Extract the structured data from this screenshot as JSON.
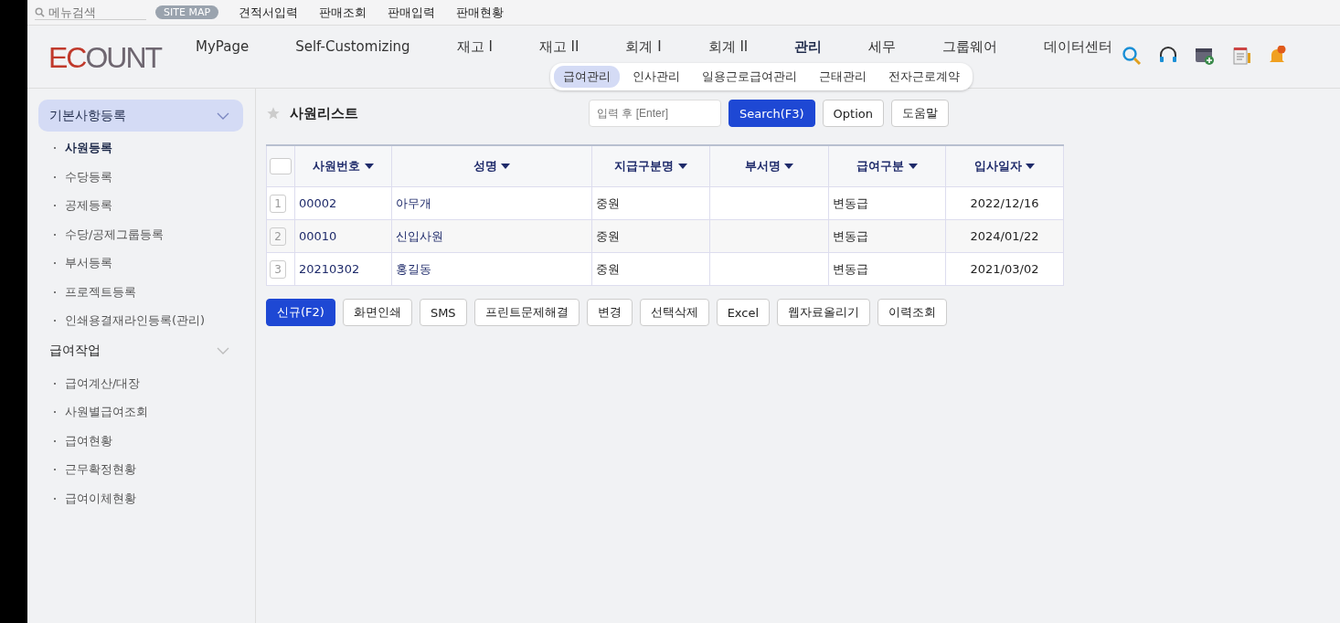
{
  "top_bar": {
    "search_placeholder": "메뉴검색",
    "site_map": "SITE MAP",
    "links": [
      "견적서입력",
      "판매조회",
      "판매입력",
      "판매현황"
    ]
  },
  "logo": "ECOUNT",
  "nav": [
    {
      "label": "MyPage",
      "selected": false
    },
    {
      "label": "Self-Customizing",
      "selected": false
    },
    {
      "label": "재고 I",
      "selected": false
    },
    {
      "label": "재고 II",
      "selected": false
    },
    {
      "label": "회계 I",
      "selected": false
    },
    {
      "label": "회계 II",
      "selected": false
    },
    {
      "label": "관리",
      "selected": true
    },
    {
      "label": "세무",
      "selected": false
    },
    {
      "label": "그룹웨어",
      "selected": false
    },
    {
      "label": "데이터센터",
      "selected": false
    }
  ],
  "sub_nav": [
    {
      "label": "급여관리",
      "selected": true
    },
    {
      "label": "인사관리",
      "selected": false
    },
    {
      "label": "일용근로급여관리",
      "selected": false
    },
    {
      "label": "근태관리",
      "selected": false
    },
    {
      "label": "전자근로계약",
      "selected": false
    }
  ],
  "sidebar": [
    {
      "label": "기본사항등록",
      "selected": true,
      "children": [
        {
          "label": "사원등록",
          "selected": true
        },
        {
          "label": "수당등록",
          "selected": false
        },
        {
          "label": "공제등록",
          "selected": false
        },
        {
          "label": "수당/공제그룹등록",
          "selected": false
        },
        {
          "label": "부서등록",
          "selected": false
        },
        {
          "label": "프로젝트등록",
          "selected": false
        },
        {
          "label": "인쇄용결재라인등록(관리)",
          "selected": false
        }
      ]
    },
    {
      "label": "급여작업",
      "selected": false,
      "children": [
        {
          "label": "급여계산/대장",
          "selected": false
        },
        {
          "label": "사원별급여조회",
          "selected": false
        },
        {
          "label": "급여현황",
          "selected": false
        },
        {
          "label": "근무확정현황",
          "selected": false
        },
        {
          "label": "급여이체현황",
          "selected": false
        }
      ]
    }
  ],
  "page_title": "사원리스트",
  "search": {
    "placeholder": "입력 후 [Enter]",
    "buttons": [
      "Search(F3)",
      "Option",
      "도움말"
    ]
  },
  "table": {
    "select_all_checked": false,
    "columns": [
      "사원번호",
      "성명",
      "지급구분명",
      "부서명",
      "급여구분",
      "입사일자"
    ],
    "rows": [
      {
        "num": "1",
        "cells": [
          "00002",
          "아무개",
          "중원",
          "",
          "변동급",
          "2022/12/16"
        ]
      },
      {
        "num": "2",
        "cells": [
          "00010",
          "신입사원",
          "중원",
          "",
          "변동급",
          "2024/01/22"
        ]
      },
      {
        "num": "3",
        "cells": [
          "20210302",
          "홍길동",
          "중원",
          "",
          "변동급",
          "2021/03/02"
        ]
      }
    ]
  },
  "actions": [
    {
      "label": "신규(F2)",
      "kind": "primary"
    },
    {
      "label": "화면인쇄",
      "kind": "default"
    },
    {
      "label": "SMS",
      "kind": "default"
    },
    {
      "label": "프린트문제해결",
      "kind": "default"
    },
    {
      "label": "변경",
      "kind": "default"
    },
    {
      "label": "선택삭제",
      "kind": "default"
    },
    {
      "label": "Excel",
      "kind": "default"
    },
    {
      "label": "웹자료올리기",
      "kind": "default"
    },
    {
      "label": "이력조회",
      "kind": "default"
    }
  ]
}
